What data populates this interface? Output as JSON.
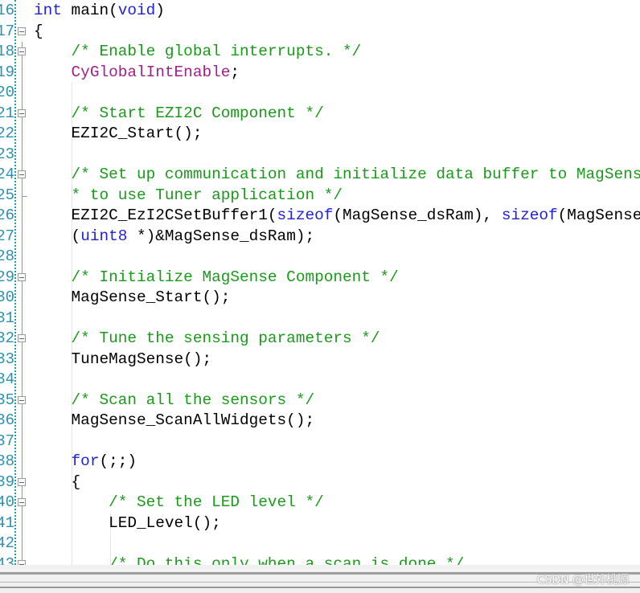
{
  "editor": {
    "lines": [
      {
        "n": "16",
        "fold": "",
        "segs": [
          {
            "t": "int",
            "c": "kw"
          },
          {
            "t": " main(",
            "c": ""
          },
          {
            "t": "void",
            "c": "kw"
          },
          {
            "t": ")",
            "c": ""
          }
        ]
      },
      {
        "n": "17",
        "fold": "open",
        "segs": [
          {
            "t": "{",
            "c": ""
          }
        ]
      },
      {
        "n": "18",
        "fold": "open",
        "segs": [
          {
            "t": "    ",
            "c": ""
          },
          {
            "t": "/* Enable global interrupts. */",
            "c": "cm"
          }
        ]
      },
      {
        "n": "19",
        "fold": "",
        "segs": [
          {
            "t": "    ",
            "c": ""
          },
          {
            "t": "CyGlobalIntEnable",
            "c": "mac"
          },
          {
            "t": ";",
            "c": ""
          }
        ]
      },
      {
        "n": "20",
        "fold": "",
        "segs": []
      },
      {
        "n": "21",
        "fold": "open",
        "segs": [
          {
            "t": "    ",
            "c": ""
          },
          {
            "t": "/* Start EZI2C Component */",
            "c": "cm"
          }
        ]
      },
      {
        "n": "22",
        "fold": "",
        "segs": [
          {
            "t": "    EZI2C_Start();",
            "c": ""
          }
        ]
      },
      {
        "n": "23",
        "fold": "",
        "segs": []
      },
      {
        "n": "24",
        "fold": "open",
        "segs": [
          {
            "t": "    ",
            "c": ""
          },
          {
            "t": "/* Set up communication and initialize data buffer to MagSense data structure",
            "c": "cm"
          }
        ]
      },
      {
        "n": "25",
        "fold": "end",
        "segs": [
          {
            "t": "    ",
            "c": ""
          },
          {
            "t": "* to use Tuner application */",
            "c": "cm"
          }
        ]
      },
      {
        "n": "26",
        "fold": "",
        "segs": [
          {
            "t": "    EZI2C_EzI2CSetBuffer1(",
            "c": ""
          },
          {
            "t": "sizeof",
            "c": "kw"
          },
          {
            "t": "(MagSense_dsRam), ",
            "c": ""
          },
          {
            "t": "sizeof",
            "c": "kw"
          },
          {
            "t": "(MagSense_dsRam),",
            "c": ""
          }
        ]
      },
      {
        "n": "27",
        "fold": "",
        "segs": [
          {
            "t": "    (",
            "c": ""
          },
          {
            "t": "uint8",
            "c": "kw"
          },
          {
            "t": " *)&MagSense_dsRam);",
            "c": ""
          }
        ]
      },
      {
        "n": "28",
        "fold": "",
        "segs": []
      },
      {
        "n": "29",
        "fold": "open",
        "segs": [
          {
            "t": "    ",
            "c": ""
          },
          {
            "t": "/* Initialize MagSense Component */",
            "c": "cm"
          }
        ]
      },
      {
        "n": "30",
        "fold": "",
        "segs": [
          {
            "t": "    MagSense_Start();",
            "c": ""
          }
        ]
      },
      {
        "n": "31",
        "fold": "",
        "segs": []
      },
      {
        "n": "32",
        "fold": "open",
        "segs": [
          {
            "t": "    ",
            "c": ""
          },
          {
            "t": "/* Tune the sensing parameters */",
            "c": "cm"
          }
        ]
      },
      {
        "n": "33",
        "fold": "",
        "segs": [
          {
            "t": "    TuneMagSense();",
            "c": ""
          }
        ]
      },
      {
        "n": "34",
        "fold": "",
        "segs": []
      },
      {
        "n": "35",
        "fold": "open",
        "segs": [
          {
            "t": "    ",
            "c": ""
          },
          {
            "t": "/* Scan all the sensors */",
            "c": "cm"
          }
        ]
      },
      {
        "n": "36",
        "fold": "",
        "segs": [
          {
            "t": "    MagSense_ScanAllWidgets();",
            "c": ""
          }
        ]
      },
      {
        "n": "37",
        "fold": "",
        "segs": []
      },
      {
        "n": "38",
        "fold": "",
        "segs": [
          {
            "t": "    ",
            "c": ""
          },
          {
            "t": "for",
            "c": "kw"
          },
          {
            "t": "(;;)",
            "c": ""
          }
        ]
      },
      {
        "n": "39",
        "fold": "open",
        "segs": [
          {
            "t": "    {",
            "c": ""
          }
        ]
      },
      {
        "n": "40",
        "fold": "open",
        "segs": [
          {
            "t": "        ",
            "c": ""
          },
          {
            "t": "/* Set the LED level */",
            "c": "cm"
          }
        ]
      },
      {
        "n": "41",
        "fold": "",
        "segs": [
          {
            "t": "        LED_Level();",
            "c": ""
          }
        ]
      },
      {
        "n": "42",
        "fold": "",
        "segs": []
      },
      {
        "n": "43",
        "fold": "open",
        "segs": [
          {
            "t": "        ",
            "c": ""
          },
          {
            "t": "/* Do this only when a scan is done */",
            "c": "cm"
          }
        ]
      }
    ]
  },
  "watermark": "CSDN @世外桃源"
}
